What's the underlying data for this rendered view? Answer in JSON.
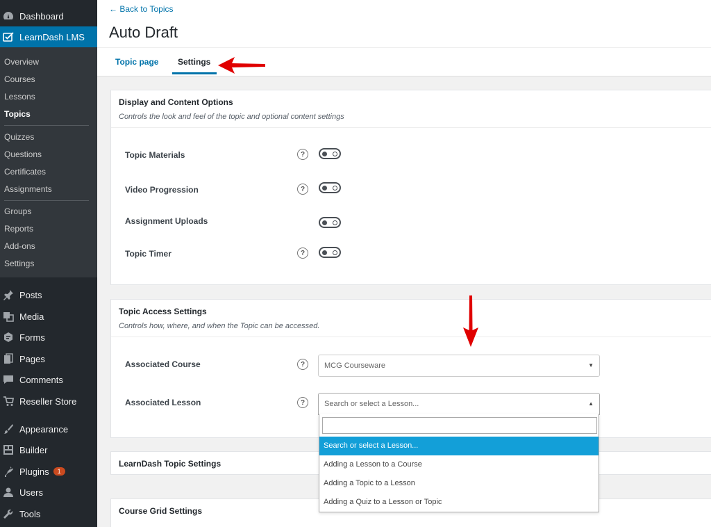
{
  "sidebar": {
    "top": [
      {
        "label": "Dashboard",
        "icon": "dashboard-icon"
      },
      {
        "label": "LearnDash LMS",
        "icon": "learndash-icon"
      }
    ],
    "submenu": [
      "Overview",
      "Courses",
      "Lessons",
      "Topics",
      "Quizzes",
      "Questions",
      "Certificates",
      "Assignments",
      "Groups",
      "Reports",
      "Add-ons",
      "Settings"
    ],
    "bottom": [
      {
        "label": "Posts",
        "icon": "pin-icon"
      },
      {
        "label": "Media",
        "icon": "media-icon"
      },
      {
        "label": "Forms",
        "icon": "forms-icon"
      },
      {
        "label": "Pages",
        "icon": "pages-icon"
      },
      {
        "label": "Comments",
        "icon": "comment-icon"
      },
      {
        "label": "Reseller Store",
        "icon": "cart-icon"
      },
      {
        "label": "Appearance",
        "icon": "brush-icon"
      },
      {
        "label": "Builder",
        "icon": "builder-icon"
      },
      {
        "label": "Plugins",
        "icon": "plug-icon",
        "badge": "1"
      },
      {
        "label": "Users",
        "icon": "user-icon"
      },
      {
        "label": "Tools",
        "icon": "wrench-icon"
      }
    ]
  },
  "header": {
    "back_link": "← Back to Topics",
    "title": "Auto Draft",
    "tabs": [
      "Topic page",
      "Settings"
    ]
  },
  "display_panel": {
    "title": "Display and Content Options",
    "desc": "Controls the look and feel of the topic and optional content settings",
    "rows": [
      "Topic Materials",
      "Video Progression",
      "Assignment Uploads",
      "Topic Timer"
    ]
  },
  "access_panel": {
    "title": "Topic Access Settings",
    "desc": "Controls how, where, and when the Topic can be accessed.",
    "course_label": "Associated Course",
    "course_value": "MCG Courseware",
    "lesson_label": "Associated Lesson",
    "lesson_placeholder": "Search or select a Lesson..."
  },
  "dropdown": {
    "options": [
      "Search or select a Lesson...",
      "Adding a Lesson to a Course",
      "Adding a Topic to a Lesson",
      "Adding a Quiz to a Lesson or Topic"
    ]
  },
  "other_panels": [
    "LearnDash Topic Settings",
    "Course Grid Settings"
  ],
  "help_glyph": "?",
  "colors": {
    "accent": "#0073aa",
    "highlight": "#139fd8",
    "sidebar": "#23282d",
    "annotation": "#e00000"
  }
}
